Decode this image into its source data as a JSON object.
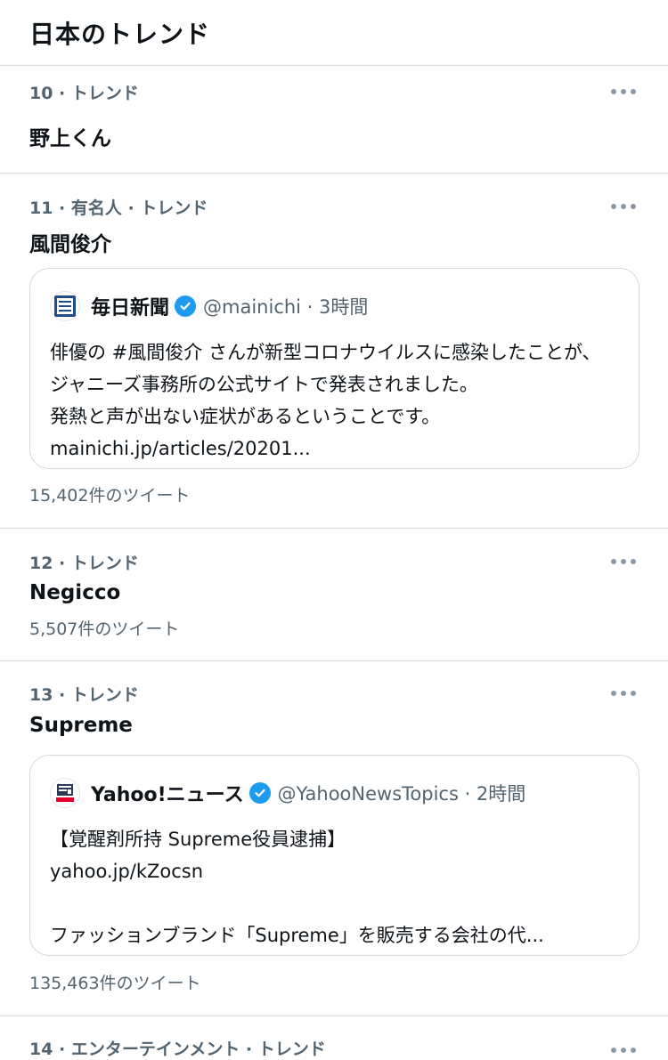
{
  "header": {
    "title": "日本のトレンド"
  },
  "trends": [
    {
      "meta": "10 · トレンド",
      "title": "野上くん"
    },
    {
      "meta": "11 · 有名人 · トレンド",
      "title": "風間俊介",
      "card": {
        "source": "毎日新聞",
        "handle": "@mainichi · 3時間",
        "text": "俳優の #風間俊介 さんが新型コロナウイルスに感染したことが、ジャニーズ事務所の公式サイトで発表されました。\n発熱と声が出ない症状があるということです。\nmainichi.jp/articles/20201..."
      },
      "count": "15,402件のツイート"
    },
    {
      "meta": "12 · トレンド",
      "title": "Negicco",
      "count": "5,507件のツイート"
    },
    {
      "meta": "13 · トレンド",
      "title": "Supreme",
      "card": {
        "source": "Yahoo!ニュース",
        "handle": "@YahooNewsTopics · 2時間",
        "text": "【覚醒剤所持 Supreme役員逮捕】\nyahoo.jp/kZocsn\n\nファッションブランド「Supreme」を販売する会社の代..."
      },
      "count": "135,463件のツイート"
    },
    {
      "meta": "14 · エンターテインメント · トレンド"
    }
  ],
  "icons": {
    "more": "more-icon",
    "verified": "verified-badge-icon"
  },
  "colors": {
    "accent": "#1d9bf0",
    "secondary_text": "#536471",
    "divider": "#cfd9de"
  }
}
